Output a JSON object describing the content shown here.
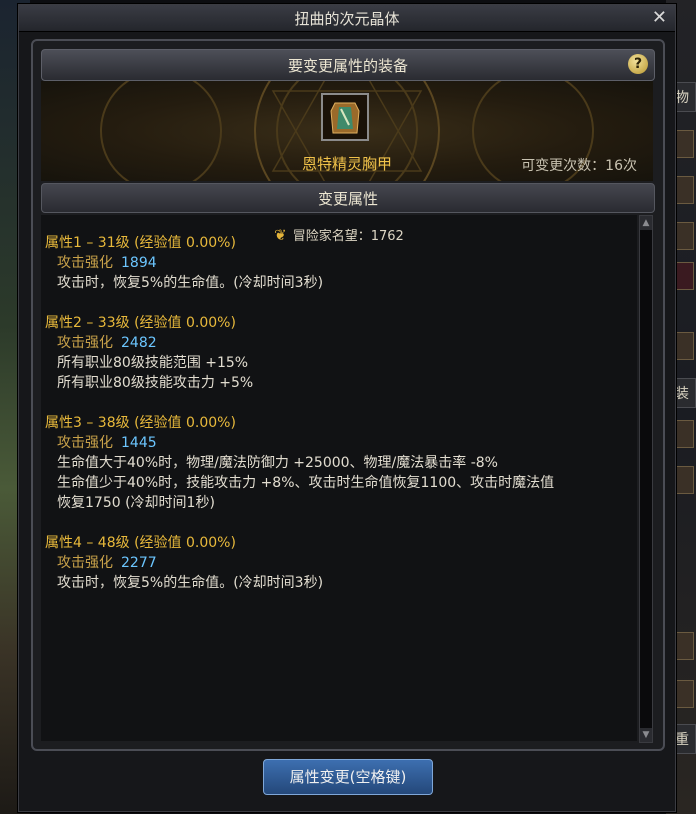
{
  "window": {
    "title": "扭曲的次元晶体",
    "close_glyph": "✕"
  },
  "equipment": {
    "header": "要变更属性的装备",
    "help_glyph": "?",
    "item_name": "恩特精灵胸甲",
    "change_count": "可变更次数：16次"
  },
  "change_section": {
    "header": "变更属性",
    "fame_label": "冒险家名望：1762",
    "attributes": [
      {
        "title": "属性1 – 31级 (经验值 0.00%)",
        "lines": [
          {
            "label": "攻击强化",
            "value": "1894"
          },
          {
            "text": "攻击时，恢复5%的生命值。(冷却时间3秒)"
          }
        ]
      },
      {
        "title": "属性2 – 33级 (经验值 0.00%)",
        "lines": [
          {
            "label": "攻击强化",
            "value": "2482"
          },
          {
            "text": "所有职业80级技能范围 +15%"
          },
          {
            "text": "所有职业80级技能攻击力 +5%"
          }
        ]
      },
      {
        "title": "属性3 – 38级 (经验值 0.00%)",
        "lines": [
          {
            "label": "攻击强化",
            "value": "1445"
          },
          {
            "text": "生命值大于40%时，物理/魔法防御力 +25000、物理/魔法暴击率 -8%"
          },
          {
            "text": "生命值少于40%时，技能攻击力 +8%、攻击时生命值恢复1100、攻击时魔法值"
          },
          {
            "text": "恢复1750 (冷却时间1秒)"
          }
        ]
      },
      {
        "title": "属性4 – 48级 (经验值 0.00%)",
        "lines": [
          {
            "label": "攻击强化",
            "value": "2277"
          },
          {
            "text": "攻击时，恢复5%的生命值。(冷却时间3秒)"
          }
        ]
      }
    ]
  },
  "action_button": {
    "label": "属性变更(空格键)"
  },
  "side": {
    "top_label": "物",
    "mid_label": "装",
    "bottom_label": "重"
  },
  "colors": {
    "gold": "#e8b93b",
    "blue_value": "#6cc6ff",
    "item_name": "#f0c24a"
  }
}
